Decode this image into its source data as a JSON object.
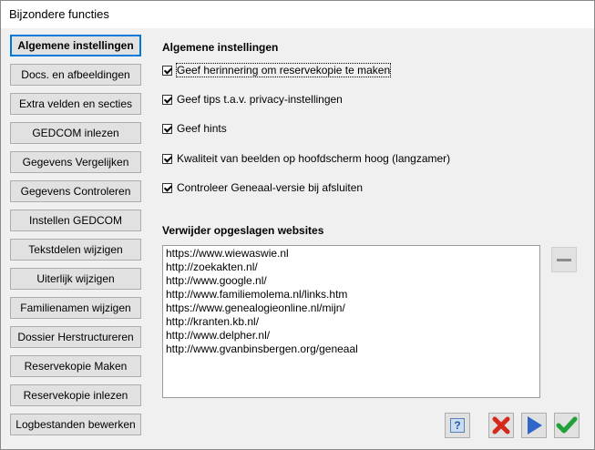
{
  "window": {
    "title": "Bijzondere functies"
  },
  "nav": {
    "items": [
      {
        "label": "Algemene instellingen",
        "name": "algemene-instellingen"
      },
      {
        "label": "Docs. en afbeeldingen",
        "name": "docs-en-afbeeldingen"
      },
      {
        "label": "Extra velden en secties",
        "name": "extra-velden-en-secties"
      },
      {
        "label": "GEDCOM inlezen",
        "name": "gedcom-inlezen"
      },
      {
        "label": "Gegevens Vergelijken",
        "name": "gegevens-vergelijken"
      },
      {
        "label": "Gegevens Controleren",
        "name": "gegevens-controleren"
      },
      {
        "label": "Instellen GEDCOM",
        "name": "instellen-gedcom"
      },
      {
        "label": "Tekstdelen wijzigen",
        "name": "tekstdelen-wijzigen"
      },
      {
        "label": "Uiterlijk wijzigen",
        "name": "uiterlijk-wijzigen"
      },
      {
        "label": "Familienamen wijzigen",
        "name": "familienamen-wijzigen"
      },
      {
        "label": "Dossier Herstructureren",
        "name": "dossier-herstructureren"
      },
      {
        "label": "Reservekopie Maken",
        "name": "reservekopie-maken"
      },
      {
        "label": "Reservekopie inlezen",
        "name": "reservekopie-inlezen"
      },
      {
        "label": "Logbestanden bewerken",
        "name": "logbestanden-bewerken"
      }
    ]
  },
  "general": {
    "heading": "Algemene instellingen",
    "options": [
      {
        "label": "Geef herinnering om reservekopie te maken",
        "checked": true
      },
      {
        "label": "Geef tips t.a.v. privacy-instellingen",
        "checked": true
      },
      {
        "label": "Geef hints",
        "checked": true
      },
      {
        "label": "Kwaliteit van beelden op hoofdscherm hoog (langzamer)",
        "checked": true
      },
      {
        "label": "Controleer Geneaal-versie bij afsluiten",
        "checked": true
      }
    ]
  },
  "websites": {
    "heading": "Verwijder opgeslagen websites",
    "items": [
      "https://www.wiewaswie.nl",
      "http://zoekakten.nl/",
      "http://www.google.nl/",
      "http://www.familiemolema.nl/links.htm",
      "https://www.genealogieonline.nl/mijn/",
      "http://kranten.kb.nl/",
      "http://www.delpher.nl/",
      "http://www.gvanbinsbergen.org/geneaal"
    ]
  },
  "buttons": {
    "help_glyph": "?"
  },
  "colors": {
    "accent": "#0078d7",
    "cancel_red": "#d42a1e",
    "play_blue": "#2f66c7",
    "ok_green": "#22a03a"
  }
}
